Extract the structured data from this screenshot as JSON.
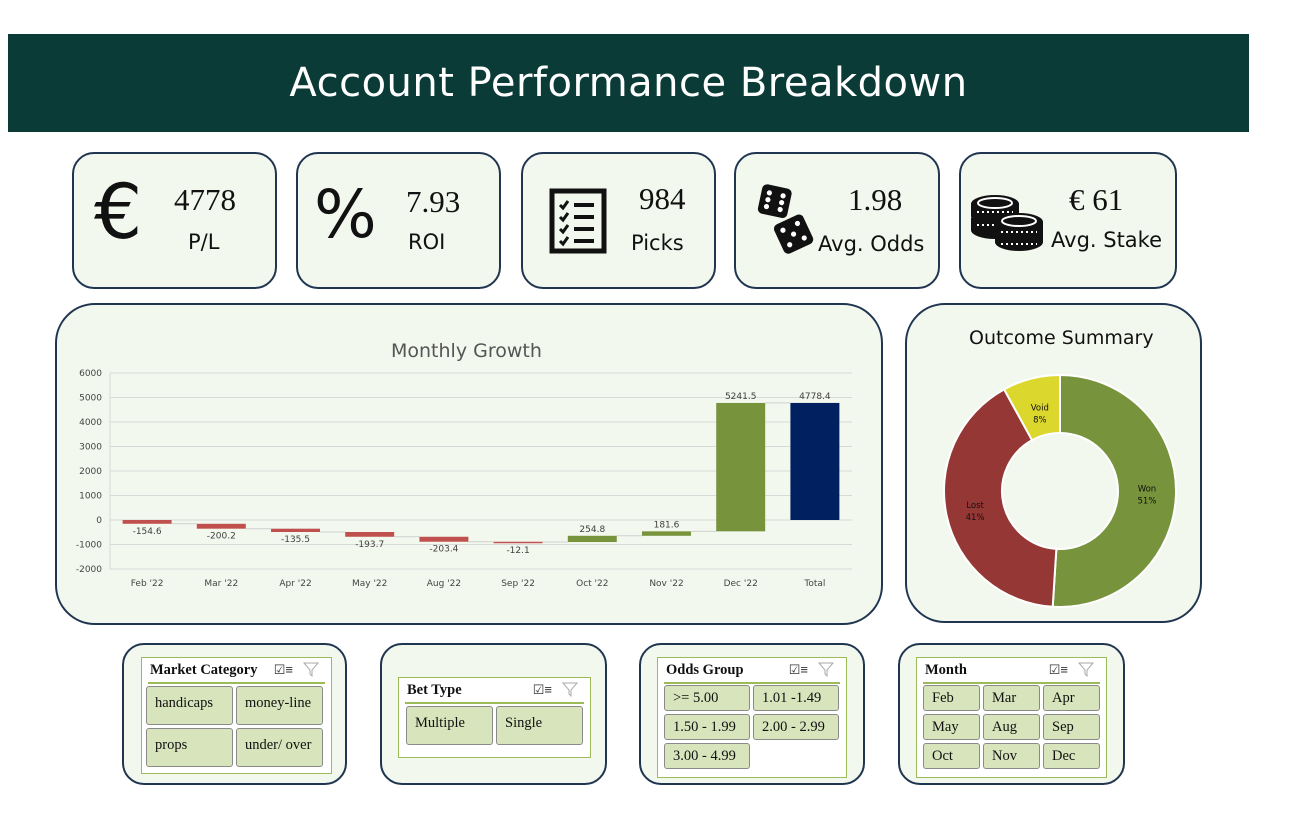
{
  "header": {
    "title": "Account Performance Breakdown"
  },
  "kpis": [
    {
      "icon": "euro-icon",
      "value": "4778",
      "label": "P/L"
    },
    {
      "icon": "percent-icon",
      "value": "7.93",
      "label": "ROI"
    },
    {
      "icon": "checklist-icon",
      "value": "984",
      "label": "Picks"
    },
    {
      "icon": "dice-icon",
      "value": "1.98",
      "label": "Avg. Odds"
    },
    {
      "icon": "coins-icon",
      "value": "€ 61",
      "label": "Avg. Stake"
    }
  ],
  "colors": {
    "header_bg": "#0a3b36",
    "card_bg": "#f3f8ee",
    "card_border": "#1f3550",
    "increase": "#77933c",
    "decrease": "#c0504d",
    "total": "#002060",
    "won": "#77933c",
    "lost": "#953735",
    "void": "#dcd72c",
    "slicer_button": "#d8e4bc"
  },
  "chart_data": [
    {
      "type": "bar",
      "subtype": "waterfall",
      "title": "Monthly Growth",
      "categories": [
        "Feb '22",
        "Mar '22",
        "Apr '22",
        "May '22",
        "Aug '22",
        "Sep '22",
        "Oct '22",
        "Nov '22",
        "Dec '22",
        "Total"
      ],
      "values": [
        -154.6,
        -200.2,
        -135.5,
        -193.7,
        -203.4,
        -12.1,
        254.8,
        181.6,
        5241.5,
        4778.4
      ],
      "labels": [
        "-154.6",
        "-200.2",
        "-135.5",
        "-193.7",
        "-203.4",
        "-12.1",
        "254.8",
        "181.6",
        "5241.5",
        "4778.4"
      ],
      "yticks": [
        "6000",
        "5000",
        "4000",
        "3000",
        "2000",
        "1000",
        "0",
        "-1000",
        "-2000"
      ],
      "ylim": [
        -2000,
        6000
      ],
      "xlabel": "",
      "ylabel": "",
      "grid": true
    },
    {
      "type": "pie",
      "subtype": "donut",
      "title": "Outcome Summary",
      "categories": [
        "Won",
        "Lost",
        "Void"
      ],
      "values": [
        51,
        41,
        8
      ],
      "labels": [
        "51%",
        "41%",
        "8%"
      ]
    }
  ],
  "slicers": [
    {
      "title": "Market Category",
      "items": [
        "handicaps",
        "money-line",
        "props",
        "under/ over"
      ]
    },
    {
      "title": "Bet Type",
      "items": [
        "Multiple",
        "Single"
      ]
    },
    {
      "title": "Odds Group",
      "items": [
        ">= 5.00",
        "1.01 -1.49",
        "1.50 - 1.99",
        "2.00 - 2.99",
        "3.00 - 4.99"
      ]
    },
    {
      "title": "Month",
      "items": [
        "Feb",
        "Mar",
        "Apr",
        "May",
        "Aug",
        "Sep",
        "Oct",
        "Nov",
        "Dec"
      ]
    }
  ]
}
